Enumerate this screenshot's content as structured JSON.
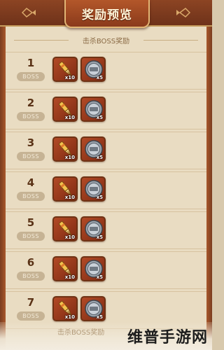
{
  "header": {
    "title": "奖励预览"
  },
  "section": {
    "subtitle": "击杀BOSS奖励"
  },
  "rows": [
    {
      "rank": "1",
      "badge": "BOSS",
      "rewards": [
        {
          "icon": "gold-pen-icon",
          "qty": "x10"
        },
        {
          "icon": "silver-coin-icon",
          "qty": "x5"
        }
      ]
    },
    {
      "rank": "2",
      "badge": "BOSS",
      "rewards": [
        {
          "icon": "gold-pen-icon",
          "qty": "x10"
        },
        {
          "icon": "silver-coin-icon",
          "qty": "x5"
        }
      ]
    },
    {
      "rank": "3",
      "badge": "BOSS",
      "rewards": [
        {
          "icon": "gold-pen-icon",
          "qty": "x10"
        },
        {
          "icon": "silver-coin-icon",
          "qty": "x5"
        }
      ]
    },
    {
      "rank": "4",
      "badge": "BOSS",
      "rewards": [
        {
          "icon": "gold-pen-icon",
          "qty": "x10"
        },
        {
          "icon": "silver-coin-icon",
          "qty": "x5"
        }
      ]
    },
    {
      "rank": "5",
      "badge": "BOSS",
      "rewards": [
        {
          "icon": "gold-pen-icon",
          "qty": "x10"
        },
        {
          "icon": "silver-coin-icon",
          "qty": "x5"
        }
      ]
    },
    {
      "rank": "6",
      "badge": "BOSS",
      "rewards": [
        {
          "icon": "gold-pen-icon",
          "qty": "x10"
        },
        {
          "icon": "silver-coin-icon",
          "qty": "x5"
        }
      ]
    },
    {
      "rank": "7",
      "badge": "BOSS",
      "rewards": [
        {
          "icon": "gold-pen-icon",
          "qty": "x10"
        },
        {
          "icon": "silver-coin-icon",
          "qty": "x5"
        }
      ]
    }
  ],
  "footer": {
    "subtitle": "击杀BOSS奖励",
    "watermark": "维普手游网"
  },
  "colors": {
    "header": "#8c4423",
    "panel": "#e9dcc2",
    "rank_text": "#5a3216",
    "badge": "#c6b394",
    "reward_bg": "#b24a26"
  }
}
